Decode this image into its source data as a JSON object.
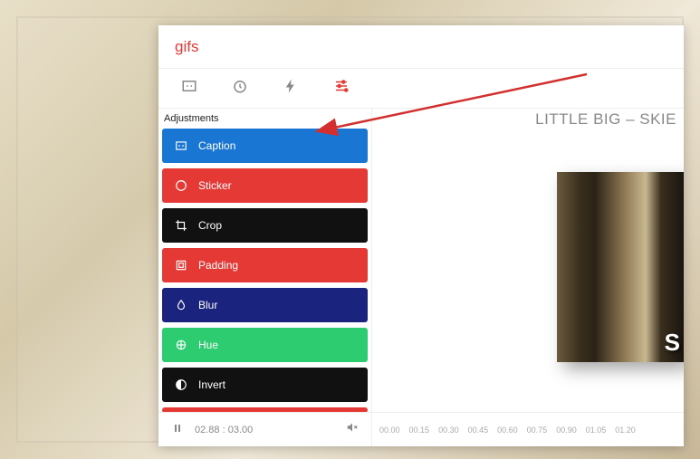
{
  "header": {
    "title": "gifs"
  },
  "toolbar": {
    "items": [
      "caption-tool",
      "timer-tool",
      "speed-tool",
      "adjustments-tool"
    ]
  },
  "sidebar": {
    "section_label": "Adjustments",
    "items": [
      {
        "label": "Caption",
        "icon": "caption-icon",
        "bg": "#1976d2"
      },
      {
        "label": "Sticker",
        "icon": "sticker-icon",
        "bg": "#e53935"
      },
      {
        "label": "Crop",
        "icon": "crop-icon",
        "bg": "#111111"
      },
      {
        "label": "Padding",
        "icon": "padding-icon",
        "bg": "#e53935"
      },
      {
        "label": "Blur",
        "icon": "blur-icon",
        "bg": "#1a237e"
      },
      {
        "label": "Hue",
        "icon": "hue-icon",
        "bg": "#2ecc71"
      },
      {
        "label": "Invert",
        "icon": "invert-icon",
        "bg": "#111111"
      }
    ]
  },
  "preview": {
    "title": "LITTLE BIG – SKIE",
    "frame_letter": "S"
  },
  "controls": {
    "play_state": "pause",
    "current_time": "02.88",
    "total_time": "03.00"
  },
  "timeline": {
    "ticks": [
      "00.00",
      "00.15",
      "00.30",
      "00.45",
      "00.60",
      "00.75",
      "00.90",
      "01.05",
      "01.20"
    ]
  },
  "colors": {
    "accent": "#e53935",
    "blue": "#1976d2",
    "darkblue": "#1a237e",
    "green": "#2ecc71",
    "black": "#111111"
  }
}
